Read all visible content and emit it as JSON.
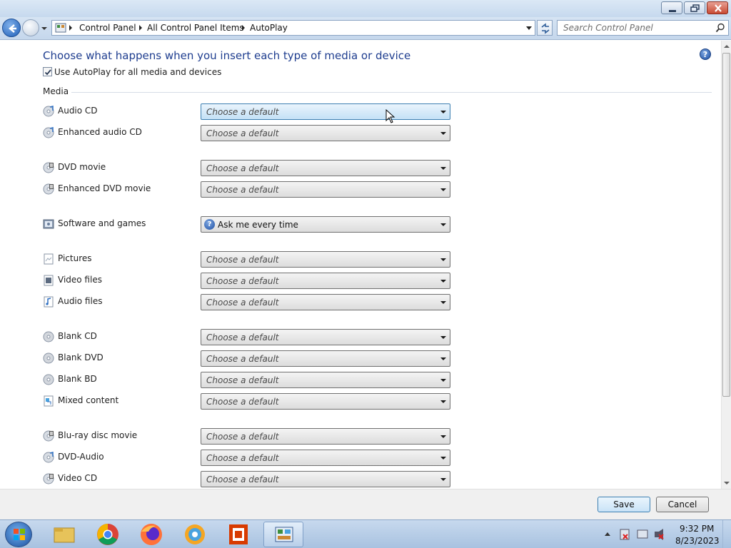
{
  "window": {
    "minimize_icon": "minimize-icon",
    "maximize_icon": "restore-icon",
    "close_icon": "close-icon"
  },
  "addressbar": {
    "breadcrumbs": [
      "Control Panel",
      "All Control Panel Items",
      "AutoPlay"
    ],
    "search_placeholder": "Search Control Panel"
  },
  "page": {
    "heading": "Choose what happens when you insert each type of media or device",
    "use_autoplay_label": "Use AutoPlay for all media and devices",
    "use_autoplay_checked": true,
    "section_media": "Media"
  },
  "media_rows": [
    {
      "label": "Audio CD",
      "value": "Choose a default",
      "icon": "audio-cd-icon"
    },
    {
      "label": "Enhanced audio CD",
      "value": "Choose a default",
      "icon": "audio-cd-icon"
    },
    {
      "label": "DVD movie",
      "value": "Choose a default",
      "icon": "dvd-movie-icon"
    },
    {
      "label": "Enhanced DVD movie",
      "value": "Choose a default",
      "icon": "dvd-movie-icon"
    },
    {
      "label": "Software and games",
      "value": "Ask me every time",
      "icon": "software-icon"
    },
    {
      "label": "Pictures",
      "value": "Choose a default",
      "icon": "pictures-icon"
    },
    {
      "label": "Video files",
      "value": "Choose a default",
      "icon": "video-file-icon"
    },
    {
      "label": "Audio files",
      "value": "Choose a default",
      "icon": "audio-file-icon"
    },
    {
      "label": "Blank CD",
      "value": "Choose a default",
      "icon": "blank-disc-icon"
    },
    {
      "label": "Blank DVD",
      "value": "Choose a default",
      "icon": "blank-disc-icon"
    },
    {
      "label": "Blank BD",
      "value": "Choose a default",
      "icon": "blank-disc-icon"
    },
    {
      "label": "Mixed content",
      "value": "Choose a default",
      "icon": "mixed-content-icon"
    },
    {
      "label": "Blu-ray disc movie",
      "value": "Choose a default",
      "icon": "dvd-movie-icon"
    },
    {
      "label": "DVD-Audio",
      "value": "Choose a default",
      "icon": "audio-cd-icon"
    },
    {
      "label": "Video CD",
      "value": "Choose a default",
      "icon": "dvd-movie-icon"
    }
  ],
  "footer": {
    "save_label": "Save",
    "cancel_label": "Cancel"
  },
  "taskbar": {
    "apps": [
      "file-explorer-icon",
      "chrome-icon",
      "firefox-icon",
      "photos-icon",
      "office-icon",
      "control-panel-icon"
    ],
    "time": "9:32 PM",
    "date": "8/23/2023"
  },
  "colors": {
    "heading": "#1e3d8f",
    "focused_combo": "#c4e1f6"
  }
}
